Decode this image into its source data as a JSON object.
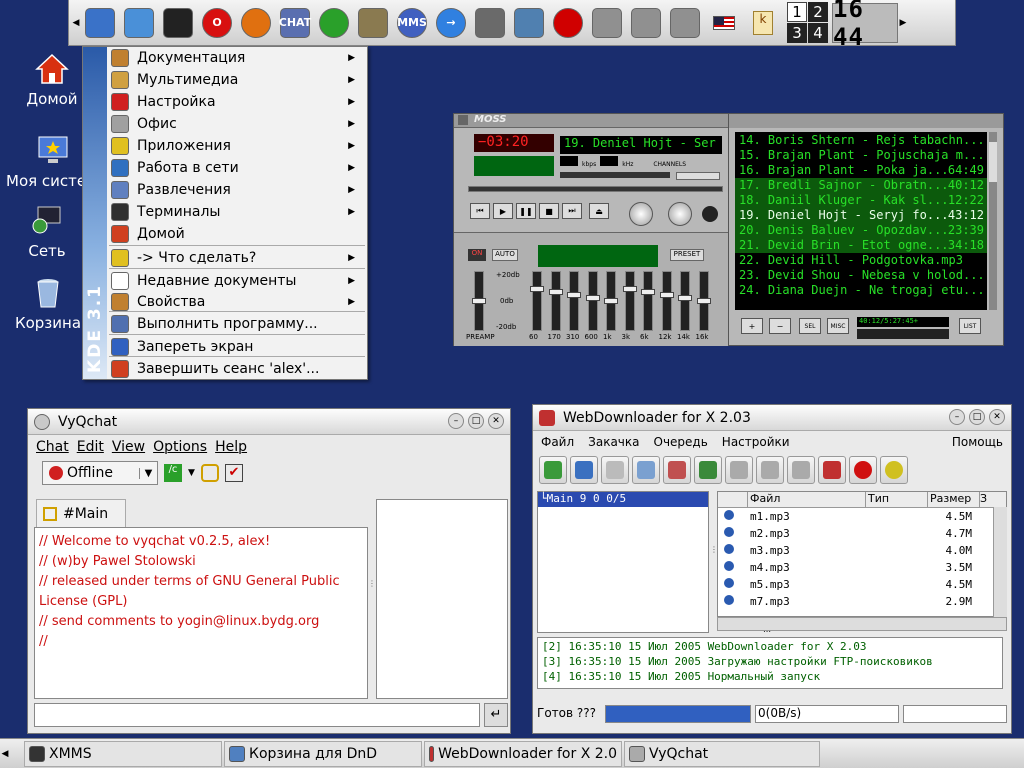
{
  "panel": {
    "launchers": [
      {
        "icon": "kde-kmenu-icon",
        "color": "#3a72c8",
        "text": ""
      },
      {
        "icon": "text-editor-icon",
        "color": "#4a90d8",
        "text": ""
      },
      {
        "icon": "terminal-icon",
        "color": "#222222",
        "text": ""
      },
      {
        "icon": "opera-icon",
        "color": "#d81010",
        "text": "O"
      },
      {
        "icon": "firefox-icon",
        "color": "#e07010",
        "text": ""
      },
      {
        "icon": "xchat-icon",
        "color": "#5a6fb0",
        "text": "CHAT"
      },
      {
        "icon": "icq-icon",
        "color": "#2aa02a",
        "text": ""
      },
      {
        "icon": "gimp-icon",
        "color": "#8a7a50",
        "text": ""
      },
      {
        "icon": "mms-icon",
        "color": "#4060c0",
        "text": "MMS"
      },
      {
        "icon": "go-icon",
        "color": "#3080e0",
        "text": "→"
      },
      {
        "icon": "pen-icon",
        "color": "#6a6a6a",
        "text": ""
      },
      {
        "icon": "document-icon",
        "color": "#5080b0",
        "text": ""
      },
      {
        "icon": "target-icon",
        "color": "#d00000",
        "text": ""
      },
      {
        "icon": "hdd1-icon",
        "color": "#909090",
        "text": ""
      },
      {
        "icon": "hdd2-icon",
        "color": "#909090",
        "text": ""
      },
      {
        "icon": "hdd3-icon",
        "color": "#909090",
        "text": ""
      }
    ],
    "keyboard_layout": "us",
    "pager": [
      "1",
      "2",
      "3",
      "4"
    ],
    "clock": "16 44"
  },
  "desktop": {
    "icons": [
      {
        "name": "desktop-icon-home",
        "label": "Домой",
        "icon": "home-icon"
      },
      {
        "name": "desktop-icon-system",
        "label": "Моя систе",
        "icon": "computer-icon"
      },
      {
        "name": "desktop-icon-network",
        "label": "Сеть",
        "icon": "network-icon"
      },
      {
        "name": "desktop-icon-trash",
        "label": "Корзина",
        "icon": "trash-icon"
      }
    ]
  },
  "kmenu": {
    "side_label": "KDE 3.1",
    "items": [
      {
        "label": "Документация",
        "arrow": true,
        "color": "#c08030"
      },
      {
        "label": "Мультимедиа",
        "arrow": true,
        "color": "#d0a040"
      },
      {
        "label": "Настройка",
        "arrow": true,
        "color": "#d02020"
      },
      {
        "label": "Офис",
        "arrow": true,
        "color": "#a0a0a0"
      },
      {
        "label": "Приложения",
        "arrow": true,
        "color": "#e0c020"
      },
      {
        "label": "Работа в сети",
        "arrow": true,
        "color": "#3070c0"
      },
      {
        "label": "Развлечения",
        "arrow": true,
        "color": "#6080c0"
      },
      {
        "label": "Терминалы",
        "arrow": true,
        "color": "#303030"
      },
      {
        "label": "Домой",
        "arrow": false,
        "color": "#d04020"
      },
      {
        "label": "-> Что сделать?",
        "arrow": true,
        "color": "#e0c020"
      },
      {
        "label": "Недавние документы",
        "arrow": true,
        "color": "#ffffff"
      },
      {
        "label": "Свойства",
        "arrow": true,
        "color": "#c08030"
      },
      {
        "label": "Выполнить программу...",
        "arrow": false,
        "color": "#5070b0"
      },
      {
        "label": "Запереть экран",
        "arrow": false,
        "color": "#3060c0"
      },
      {
        "label": "Завершить сеанс 'alex'...",
        "arrow": false,
        "color": "#d04020"
      }
    ]
  },
  "moss": {
    "logo": "MOSS",
    "track_title": "19. Deniel Hojt - Ser",
    "kbps_label": "kbps",
    "khz_label": "kHz",
    "channels_label": "CHANNELS",
    "on_label": "ON",
    "auto_label": "AUTO",
    "preset_label": "PRESET",
    "db_labels": [
      "+20db",
      "0db",
      "-20db"
    ],
    "preamp_label": "PREAMP",
    "eq_bands": [
      "60",
      "170",
      "310",
      "600",
      "1k",
      "3k",
      "6k",
      "12k",
      "14k",
      "16k"
    ],
    "playlist": [
      {
        "text": "14. Boris Shtern - Rejs tabachn...",
        "time": ""
      },
      {
        "text": "15. Brajan Plant - Pojuschaja m...",
        "time": ""
      },
      {
        "text": "16. Brajan Plant - Poka ja...",
        "time": "64:49"
      },
      {
        "text": "17. Bredli Sajnor - Obratn...",
        "time": "40:12"
      },
      {
        "text": "18. Daniil Kluger - Kak sl...",
        "time": "12:22"
      },
      {
        "text": "19. Deniel Hojt - Seryj fo...",
        "time": "43:12"
      },
      {
        "text": "20. Denis Baluev - Opozdav...",
        "time": "23:39"
      },
      {
        "text": "21. Devid Brin - Etot ogne...",
        "time": "34:18"
      },
      {
        "text": "22. Devid Hill - Podgotovka.mp3",
        "time": ""
      },
      {
        "text": "23. Devid Shou - Nebesa v holod...",
        "time": ""
      },
      {
        "text": "24. Diana Duejn - Ne trogaj etu...",
        "time": ""
      }
    ],
    "pl_buttons": [
      "+",
      "−",
      "SEL",
      "MISC"
    ],
    "pl_list_label": "LIST",
    "pl_time": "40:12/5:27:45+"
  },
  "vyqchat": {
    "title": "VyQchat",
    "menu": [
      "Chat",
      "Edit",
      "View",
      "Options",
      "Help"
    ],
    "status": "Offline",
    "tab": "#Main",
    "messages": [
      "// Welcome to vyqchat v0.2.5, alex!",
      "// (w)by Pawel Stolowski",
      "// released under terms of GNU General Public",
      "License (GPL)",
      "// send comments to yogin@linux.bydg.org",
      "//"
    ]
  },
  "webdl": {
    "title": "WebDownloader for X 2.03",
    "menu": [
      "Файл",
      "Закачка",
      "Очередь",
      "Настройки"
    ],
    "help": "Помощь",
    "tree_item": "└Main 9 0 0/5",
    "columns": [
      "Файл",
      "Тип",
      "Размер",
      "З"
    ],
    "files": [
      {
        "name": "m1.mp3",
        "size": "4.5M"
      },
      {
        "name": "m2.mp3",
        "size": "4.7M"
      },
      {
        "name": "m3.mp3",
        "size": "4.0M"
      },
      {
        "name": "m4.mp3",
        "size": "3.5M"
      },
      {
        "name": "m5.mp3",
        "size": "4.5M"
      },
      {
        "name": "m7.mp3",
        "size": "2.9M"
      }
    ],
    "log": [
      "[2] 16:35:10 15 Июл 2005 WebDownloader for X 2.03",
      "[3] 16:35:10 15 Июл 2005 Загружаю настройки FTP-поисковиков",
      "[4] 16:35:10 15 Июл 2005 Нормальный запуск"
    ],
    "status_ready": "Готов ??? ",
    "status_speed": "0(0B/s)"
  },
  "taskbar": {
    "tasks": [
      {
        "label": "XMMS",
        "icon": "xmms-icon"
      },
      {
        "label": "Корзина для DnD",
        "icon": "trash-icon"
      },
      {
        "label": "WebDownloader for X 2.0",
        "icon": "webdl-icon"
      },
      {
        "label": "VyQchat",
        "icon": "vyqchat-icon"
      }
    ]
  }
}
